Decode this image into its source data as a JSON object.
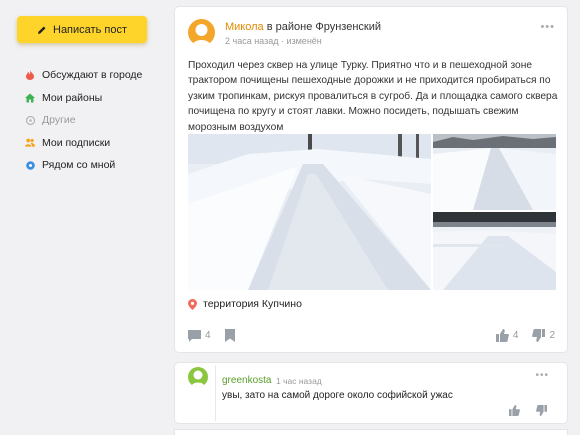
{
  "sidebar": {
    "write_button": "Написать пост",
    "items": [
      {
        "label": "Обсуждают в городе",
        "icon": "fire-icon",
        "color": "#f05a4a"
      },
      {
        "label": "Мои районы",
        "icon": "home-icon",
        "color": "#3fb34f"
      },
      {
        "label": "Другие",
        "icon": "circle-plus-icon",
        "color": "#b5b5b5"
      },
      {
        "label": "Мои подписки",
        "icon": "people-icon",
        "color": "#f6a31b"
      },
      {
        "label": "Рядом со мной",
        "icon": "location-dot-icon",
        "color": "#3b8fe0"
      }
    ]
  },
  "post": {
    "author": "Микола",
    "area": "в районе Фрунзенский",
    "time": "2 часа назад",
    "edited": "изменён",
    "text": "Проходил через сквер на улице Турку. Приятно что и в пешеходной зоне трактором почищены пешеходные дорожки и не приходится пробираться по узким тропинкам, рискуя провалиться в сугроб. Да и площадка самого сквера почищена по кругу и стоят лавки. Можно посидеть, подышать свежим морозным воздухом",
    "location": "территория Купчино",
    "comments_count": "4",
    "likes": "4",
    "dislikes": "2"
  },
  "comment": {
    "author": "greenkosta",
    "time": "1 час назад",
    "text": "увы, зато на самой дороге около софийской ужас"
  },
  "colors": {
    "accent": "#fed42b",
    "author": "#e08b00",
    "comment_author": "#5aa02c"
  }
}
